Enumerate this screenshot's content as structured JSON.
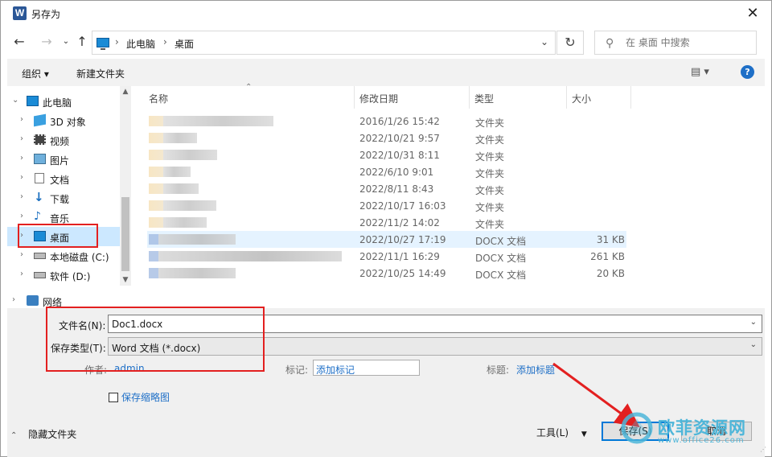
{
  "window": {
    "title": "另存为",
    "app_icon": "W"
  },
  "nav": {
    "back_icon": "arrow-left-icon",
    "forward_icon": "arrow-right-icon",
    "up_icon": "arrow-up-icon",
    "breadcrumb": [
      "此电脑",
      "桌面"
    ],
    "search_placeholder": "在 桌面 中搜索"
  },
  "toolbar": {
    "organize": "组织 ▾",
    "new_folder": "新建文件夹"
  },
  "sidebar": {
    "items": [
      {
        "label": "此电脑",
        "icon": "computer-icon"
      },
      {
        "label": "3D 对象",
        "icon": "cube-3d-icon"
      },
      {
        "label": "视频",
        "icon": "video-icon"
      },
      {
        "label": "图片",
        "icon": "pictures-icon"
      },
      {
        "label": "文档",
        "icon": "documents-icon"
      },
      {
        "label": "下载",
        "icon": "download-icon"
      },
      {
        "label": "音乐",
        "icon": "music-icon"
      },
      {
        "label": "桌面",
        "icon": "desktop-icon"
      },
      {
        "label": "本地磁盘 (C:)",
        "icon": "drive-icon"
      },
      {
        "label": "软件 (D:)",
        "icon": "drive-icon"
      },
      {
        "label": "网络",
        "icon": "network-icon"
      }
    ]
  },
  "columns": {
    "name": "名称",
    "date": "修改日期",
    "type": "类型",
    "size": "大小"
  },
  "files": [
    {
      "date": "2016/1/26 15:42",
      "type": "文件夹",
      "size": ""
    },
    {
      "date": "2022/10/21 9:57",
      "type": "文件夹",
      "size": ""
    },
    {
      "date": "2022/10/31 8:11",
      "type": "文件夹",
      "size": ""
    },
    {
      "date": "2022/6/10 9:01",
      "type": "文件夹",
      "size": ""
    },
    {
      "date": "2022/8/11 8:43",
      "type": "文件夹",
      "size": ""
    },
    {
      "date": "2022/10/17 16:03",
      "type": "文件夹",
      "size": ""
    },
    {
      "date": "2022/11/2 14:02",
      "type": "文件夹",
      "size": ""
    },
    {
      "date": "2022/10/27 17:19",
      "type": "DOCX 文档",
      "size": "31 KB"
    },
    {
      "date": "2022/11/1 16:29",
      "type": "DOCX 文档",
      "size": "261 KB"
    },
    {
      "date": "2022/10/25 14:49",
      "type": "DOCX 文档",
      "size": "20 KB"
    }
  ],
  "form": {
    "filename_label": "文件名(N):",
    "filename_value": "Doc1.docx",
    "filetype_label": "保存类型(T):",
    "filetype_value": "Word 文档 (*.docx)",
    "author_label": "作者:",
    "author_value": "admin",
    "tags_label": "标记:",
    "tags_value": "添加标记",
    "title_label": "标题:",
    "title_value": "添加标题",
    "thumbnail_label": "保存缩略图",
    "hide_folders": "隐藏文件夹",
    "tools": "工具(L)",
    "save": "保存(S)",
    "cancel": "取消"
  },
  "watermark": {
    "title": "欧菲资源网",
    "url": "www.office26.com"
  },
  "colors": {
    "accent": "#0078d7",
    "link": "#1e6fc7",
    "annotation": "#e32020",
    "selection": "#cce8ff"
  }
}
